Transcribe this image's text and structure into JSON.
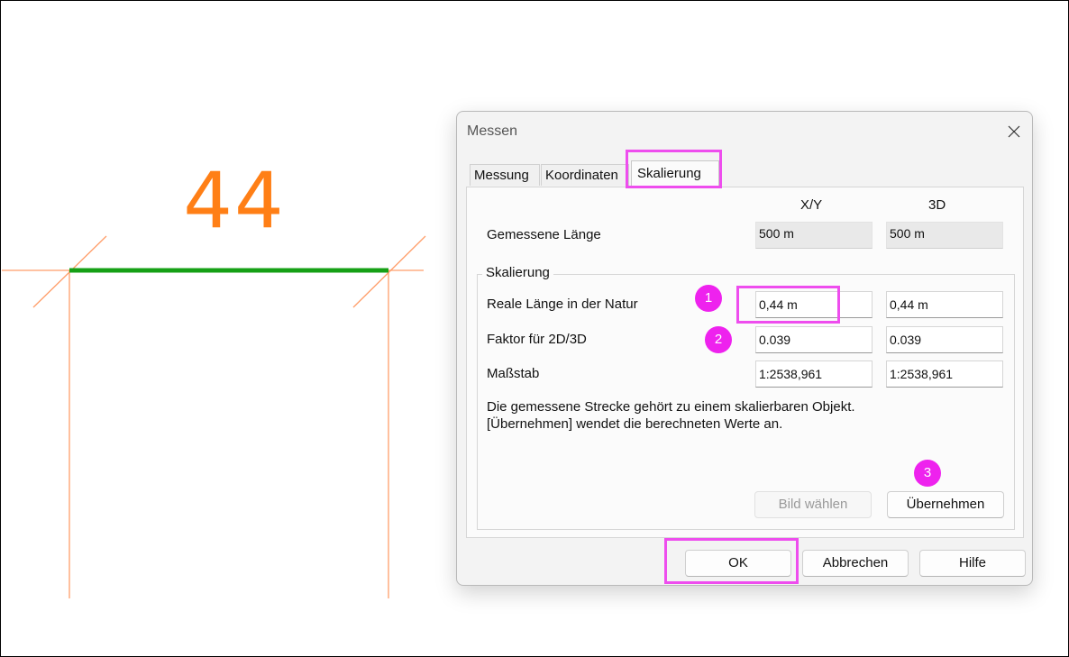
{
  "drawing": {
    "measure_label": "44",
    "colors": {
      "measure_line": "#16a016",
      "construction": "#ff9e6a",
      "label": "#ff7f16"
    }
  },
  "dialog": {
    "title": "Messen",
    "tabs": [
      "Messung",
      "Koordinaten",
      "Skalierung"
    ],
    "active_tab": "Skalierung",
    "columns": {
      "xy": "X/Y",
      "three_d": "3D"
    },
    "measured": {
      "label": "Gemessene Länge",
      "xy": "500 m",
      "three_d": "500 m"
    },
    "group_label": "Skalierung",
    "rows": [
      {
        "label": "Reale Länge in der Natur",
        "xy": "0,44 m",
        "three_d": "0,44 m"
      },
      {
        "label": "Faktor für 2D/3D",
        "xy": "0.039",
        "three_d": "0.039"
      },
      {
        "label": "Maßstab",
        "xy": "1:2538,961",
        "three_d": "1:2538,961"
      }
    ],
    "info_lines": [
      "Die gemessene Strecke gehört zu einem skalierbaren Objekt.",
      "[Übernehmen] wendet die berechneten Werte an."
    ],
    "buttons": {
      "choose_image": "Bild wählen",
      "apply": "Übernehmen",
      "ok": "OK",
      "cancel": "Abbrechen",
      "help": "Hilfe"
    }
  },
  "annotations": {
    "badges": [
      "1",
      "2",
      "3"
    ],
    "highlight_color": "#ee4dee"
  }
}
